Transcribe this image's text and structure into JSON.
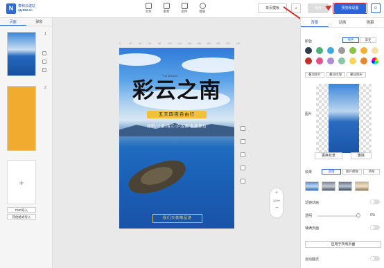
{
  "header": {
    "brand_name": "泰和云建站",
    "brand_url": "qty592.cn",
    "tools": [
      {
        "label": "文本"
      },
      {
        "label": "素材"
      },
      {
        "label": "组件"
      },
      {
        "label": "模板"
      }
    ],
    "buttons": {
      "single_page_template": "单页模板",
      "save": "保存",
      "preview": "预览和设置"
    }
  },
  "left_panel": {
    "tabs": [
      "页面",
      "弹窗"
    ],
    "pages": [
      {
        "number": "1"
      },
      {
        "number": "2"
      }
    ],
    "psd_import": "PSD导入",
    "other_import": "其他格式导入"
  },
  "canvas": {
    "ruler_marks": [
      "0",
      "20",
      "40",
      "60",
      "80",
      "100",
      "120",
      "140",
      "160",
      "180",
      "200",
      "220",
      "240"
    ],
    "title": "彩云之南",
    "subtitle_en": "YONNAN",
    "tagline": "五天四夜自由行",
    "places": "昆明/沙溪/丽江/泸沽湖/香格里拉",
    "footer_btn": "我们只做精品游",
    "zoom": "100%"
  },
  "right_panel": {
    "tabs": [
      "背景",
      "动画",
      "弹幕"
    ],
    "color_label": "颜色",
    "color_modes": [
      "纯色",
      "渐变"
    ],
    "colors": [
      "#2f3b4a",
      "#4ab07a",
      "#3fa9e0",
      "#9a9a9a",
      "#8ac34a",
      "#f3b234",
      "#f6dfa6",
      "#c0312b",
      "#e34f8a",
      "#b08ad8",
      "#86c5a6",
      "#f9d55a",
      "#e8882f",
      "#7a5fd6"
    ],
    "bg_tabs": [
      "叠加图片",
      "叠加纹理",
      "叠加图形"
    ],
    "image_label": "图片",
    "change_bg": "更换背景",
    "delete": "删除",
    "effect_label": "效果",
    "effect_modes": [
      "滤镜",
      "图片模糊",
      "清晰"
    ],
    "blur_label": "滤镜动画",
    "opacity_label": "透明",
    "opacity_value": "0%",
    "fixed_label": "铺满页面",
    "apply_all": "应用于所有页面",
    "autoplay_label": "自动翻页"
  }
}
